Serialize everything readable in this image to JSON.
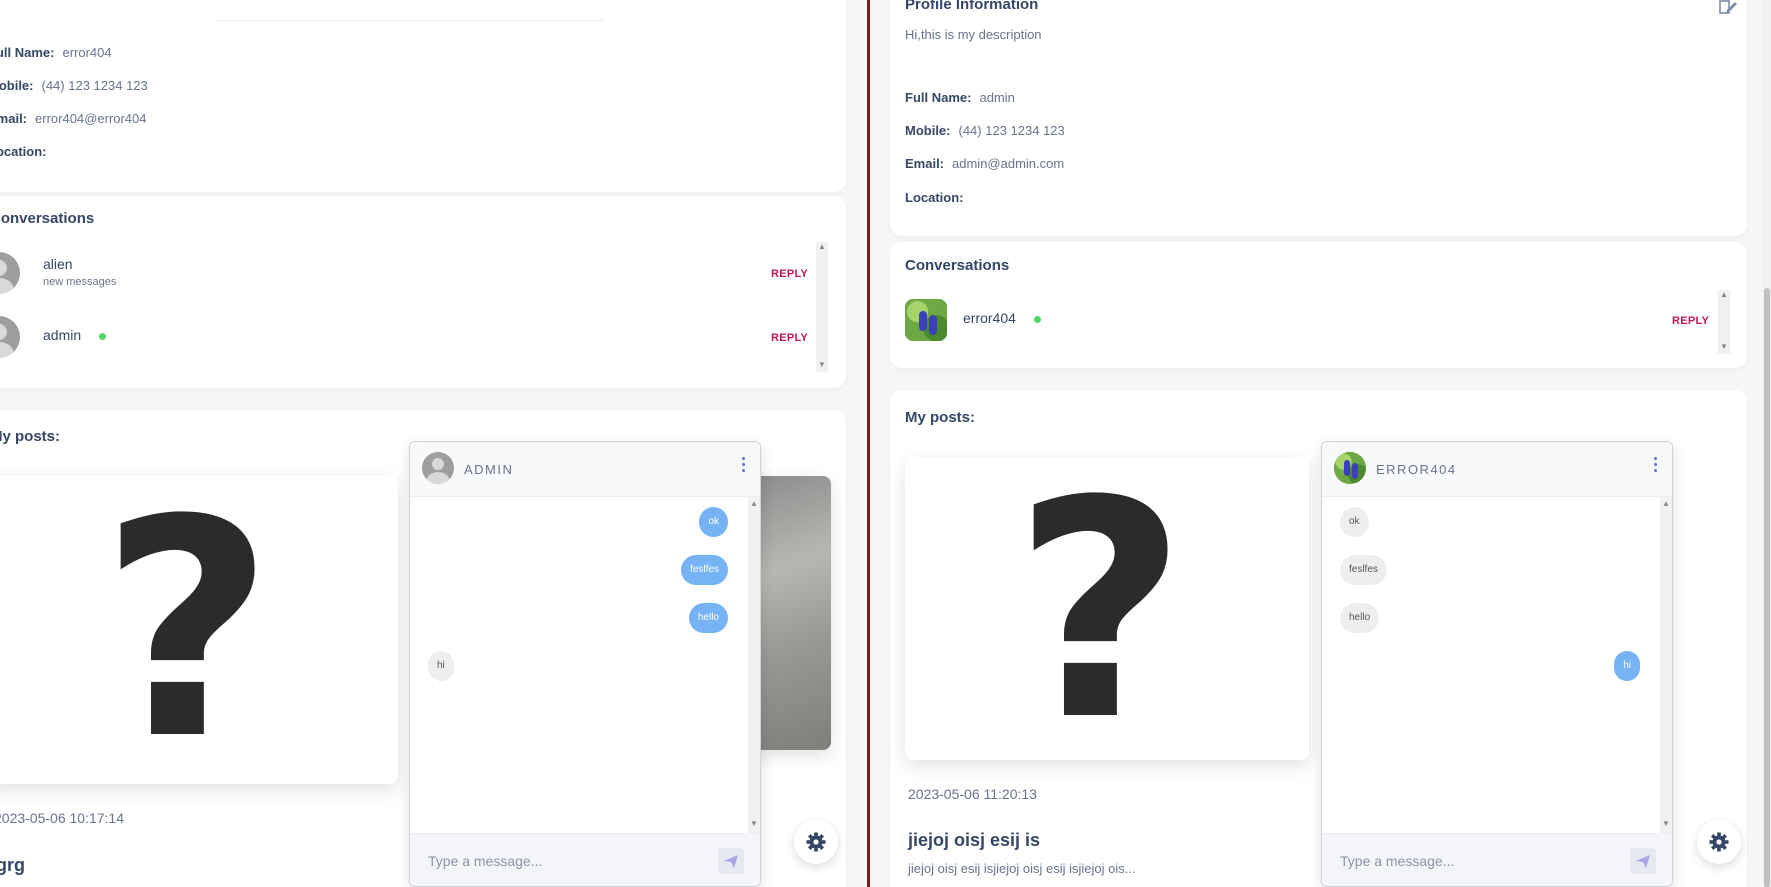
{
  "left": {
    "profile": {
      "full_name_label": "Full Name:",
      "full_name": "error404",
      "mobile_label": "Mobile:",
      "mobile": "(44) 123 1234 123",
      "email_label": "Email:",
      "email": "error404@error404",
      "location_label": "Location:",
      "location": ""
    },
    "conversations": {
      "title": "Conversations",
      "items": [
        {
          "name": "alien",
          "sub": "new messages",
          "reply": "REPLY"
        },
        {
          "name": "admin",
          "sub": "",
          "reply": "REPLY"
        }
      ]
    },
    "posts": {
      "title": "My posts:",
      "date": "2023-05-06 10:17:14",
      "title_text": "grg"
    },
    "chat": {
      "header": "ADMIN",
      "messages": [
        {
          "text": "ok",
          "from": "me"
        },
        {
          "text": "feslfes",
          "from": "me"
        },
        {
          "text": "hello",
          "from": "me"
        },
        {
          "text": "hi",
          "from": "them"
        }
      ],
      "placeholder": "Type a message..."
    }
  },
  "right": {
    "profile": {
      "heading": "Profile Information",
      "description": "Hi,this is my description",
      "full_name_label": "Full Name:",
      "full_name": "admin",
      "mobile_label": "Mobile:",
      "mobile": "(44) 123 1234 123",
      "email_label": "Email:",
      "email": "admin@admin.com",
      "location_label": "Location:",
      "location": ""
    },
    "conversations": {
      "title": "Conversations",
      "items": [
        {
          "name": "error404",
          "reply": "REPLY"
        }
      ]
    },
    "posts": {
      "title": "My posts:",
      "date": "2023-05-06 11:20:13",
      "title_text": "jiejoj oisj esij is",
      "desc": "jiejoj oisj esij isjiejoj oisj esij isjiejoj ois..."
    },
    "chat": {
      "header": "ERROR404",
      "messages": [
        {
          "text": "ok",
          "from": "them"
        },
        {
          "text": "feslfes",
          "from": "them"
        },
        {
          "text": "hello",
          "from": "them"
        },
        {
          "text": "hi",
          "from": "me"
        }
      ],
      "placeholder": "Type a message..."
    }
  },
  "icons": {
    "question": "?",
    "gear": "gear-icon",
    "send": "send-icon",
    "edit": "edit-icon"
  },
  "colors": {
    "reply": "#c2185b",
    "online": "#4cd964",
    "bubble_me": "#76b3f5",
    "accent": "#5e72e4"
  }
}
